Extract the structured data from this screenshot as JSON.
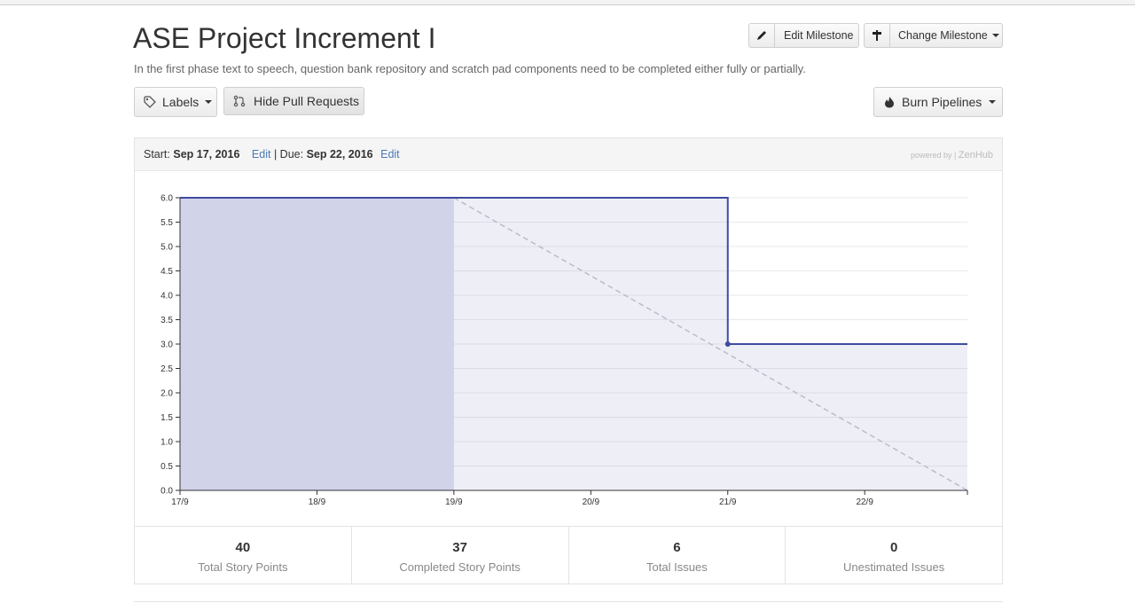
{
  "milestone": {
    "title": "ASE Project Increment I",
    "description": "In the first phase text to speech, question bank repository and scratch pad components need to be completed either fully or partially."
  },
  "toolbar": {
    "edit_label": "Edit Milestone",
    "change_label": "Change Milestone",
    "labels_label": "Labels",
    "hide_pr_label": "Hide Pull Requests",
    "burn_label": "Burn Pipelines"
  },
  "dates": {
    "start_label": "Start:",
    "start_value": "Sep 17, 2016",
    "edit_start": "Edit",
    "separator": "|",
    "due_label": "Due:",
    "due_value": "Sep 22, 2016",
    "edit_due": "Edit"
  },
  "powered": {
    "prefix": "powered by |",
    "brand": "ZenHub"
  },
  "colors": {
    "accent": "#3f4ba0",
    "link": "#4a7ab8",
    "ideal": "#bbbbcc"
  },
  "chart_data": {
    "type": "line",
    "x_ticks": [
      "17/9",
      "18/9",
      "19/9",
      "20/9",
      "21/9",
      "22/9"
    ],
    "y_ticks": [
      "0.0",
      "0.5",
      "1.0",
      "1.5",
      "2.0",
      "2.5",
      "3.0",
      "3.5",
      "4.0",
      "4.5",
      "5.0",
      "5.5",
      "6.0"
    ],
    "ylim": [
      0,
      6
    ],
    "xlim": [
      0,
      5.75
    ],
    "grid": true,
    "actual": [
      [
        0,
        6
      ],
      [
        4,
        6
      ],
      [
        4,
        3
      ],
      [
        5.75,
        3
      ]
    ],
    "ideal": [
      [
        2,
        6
      ],
      [
        5.75,
        0
      ]
    ],
    "shaded_until": 2,
    "marker": [
      4,
      3
    ]
  },
  "stats": [
    {
      "value": "40",
      "label": "Total Story Points"
    },
    {
      "value": "37",
      "label": "Completed Story Points"
    },
    {
      "value": "6",
      "label": "Total Issues"
    },
    {
      "value": "0",
      "label": "Unestimated Issues"
    }
  ]
}
